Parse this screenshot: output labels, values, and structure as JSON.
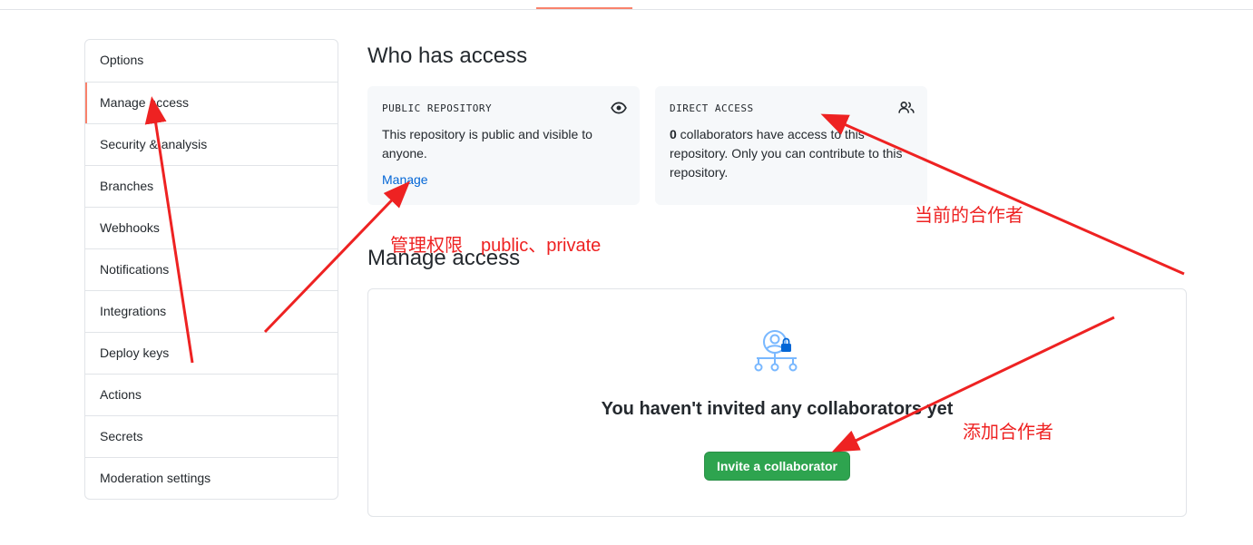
{
  "sidebar": {
    "items": [
      {
        "label": "Options"
      },
      {
        "label": "Manage access"
      },
      {
        "label": "Security & analysis"
      },
      {
        "label": "Branches"
      },
      {
        "label": "Webhooks"
      },
      {
        "label": "Notifications"
      },
      {
        "label": "Integrations"
      },
      {
        "label": "Deploy keys"
      },
      {
        "label": "Actions"
      },
      {
        "label": "Secrets"
      },
      {
        "label": "Moderation settings"
      }
    ],
    "selected": "Manage access"
  },
  "who_has_access": {
    "title": "Who has access",
    "public_card": {
      "label": "PUBLIC REPOSITORY",
      "text": "This repository is public and visible to anyone.",
      "link": "Manage",
      "icon": "eye-icon"
    },
    "direct_card": {
      "label": "DIRECT ACCESS",
      "count": "0",
      "text": " collaborators have access to this repository. Only you can contribute to this repository.",
      "icon": "people-icon"
    }
  },
  "manage_access": {
    "title": "Manage access",
    "empty_message": "You haven't invited any collaborators yet",
    "invite_button": "Invite a collaborator",
    "icon": "person-lock-icon"
  },
  "annotations": {
    "permissions": "管理权限　public、private",
    "current_collaborators": "当前的合作者",
    "add_collaborator": "添加合作者"
  },
  "colors": {
    "accent": "#f9826c",
    "link": "#0366d6",
    "button": "#2ea44f",
    "annotation": "#ee2222"
  }
}
